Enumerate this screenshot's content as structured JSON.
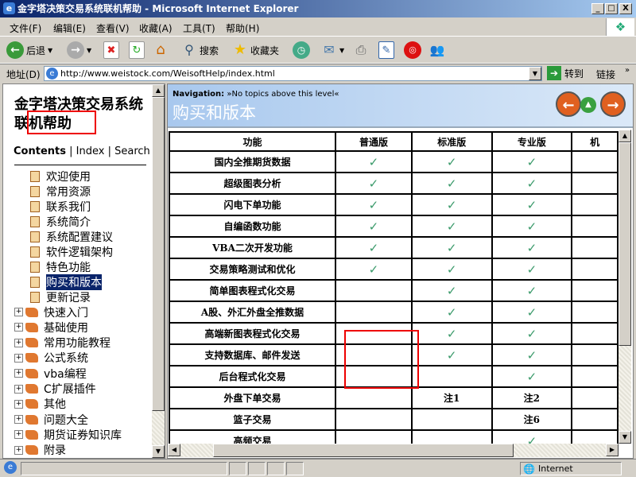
{
  "window": {
    "title": "金字塔决策交易系统联机帮助 - Microsoft Internet Explorer"
  },
  "menu": [
    "文件(F)",
    "编辑(E)",
    "查看(V)",
    "收藏(A)",
    "工具(T)",
    "帮助(H)"
  ],
  "toolbar": {
    "back": "后退",
    "search": "搜索",
    "favorites": "收藏夹"
  },
  "address": {
    "label": "地址(D)",
    "url": "http://www.weistock.com/WeisoftHelp/index.html",
    "go": "转到",
    "links": "链接"
  },
  "sidebar": {
    "title": "金字塔决策交易系统联机帮助",
    "tabs": {
      "contents": "Contents",
      "sep": "|",
      "index": "Index",
      "search": "Search"
    },
    "pages": [
      "欢迎使用",
      "常用资源",
      "联系我们",
      "系统简介",
      "系统配置建议",
      "软件逻辑架构",
      "特色功能",
      "购买和版本",
      "更新记录"
    ],
    "selected": "购买和版本",
    "books": [
      "快速入门",
      "基础使用",
      "常用功能教程",
      "公式系统",
      "vba编程",
      "C扩展插件",
      "其他",
      "问题大全",
      "期货证券知识库",
      "附录"
    ]
  },
  "content": {
    "nav_label": "Navigation:",
    "nav_text": "»No topics above this level«",
    "title": "购买和版本",
    "headers": [
      "功能",
      "普通版",
      "标准版",
      "专业版",
      "机"
    ],
    "rows": [
      [
        "国内全推期货数据",
        "✓",
        "✓",
        "✓"
      ],
      [
        "超级图表分析",
        "✓",
        "✓",
        "✓"
      ],
      [
        "闪电下单功能",
        "✓",
        "✓",
        "✓"
      ],
      [
        "自编函数功能",
        "✓",
        "✓",
        "✓"
      ],
      [
        "VBA二次开发功能",
        "✓",
        "✓",
        "✓"
      ],
      [
        "交易策略测试和优化",
        "✓",
        "✓",
        "✓"
      ],
      [
        "简单图表程式化交易",
        "",
        "✓",
        "✓"
      ],
      [
        "A股、外汇外盘全推数据",
        "",
        "✓",
        "✓"
      ],
      [
        "高端新图表程式化交易",
        "",
        "✓",
        "✓"
      ],
      [
        "支持数据库、邮件发送",
        "",
        "✓",
        "✓"
      ],
      [
        "后台程式化交易",
        "",
        "",
        "✓"
      ],
      [
        "外盘下单交易",
        "",
        "注1",
        "注2"
      ],
      [
        "篮子交易",
        "",
        "",
        "注6"
      ],
      [
        "高频交易",
        "",
        "",
        "✓"
      ]
    ]
  },
  "status": {
    "zone": "Internet"
  }
}
